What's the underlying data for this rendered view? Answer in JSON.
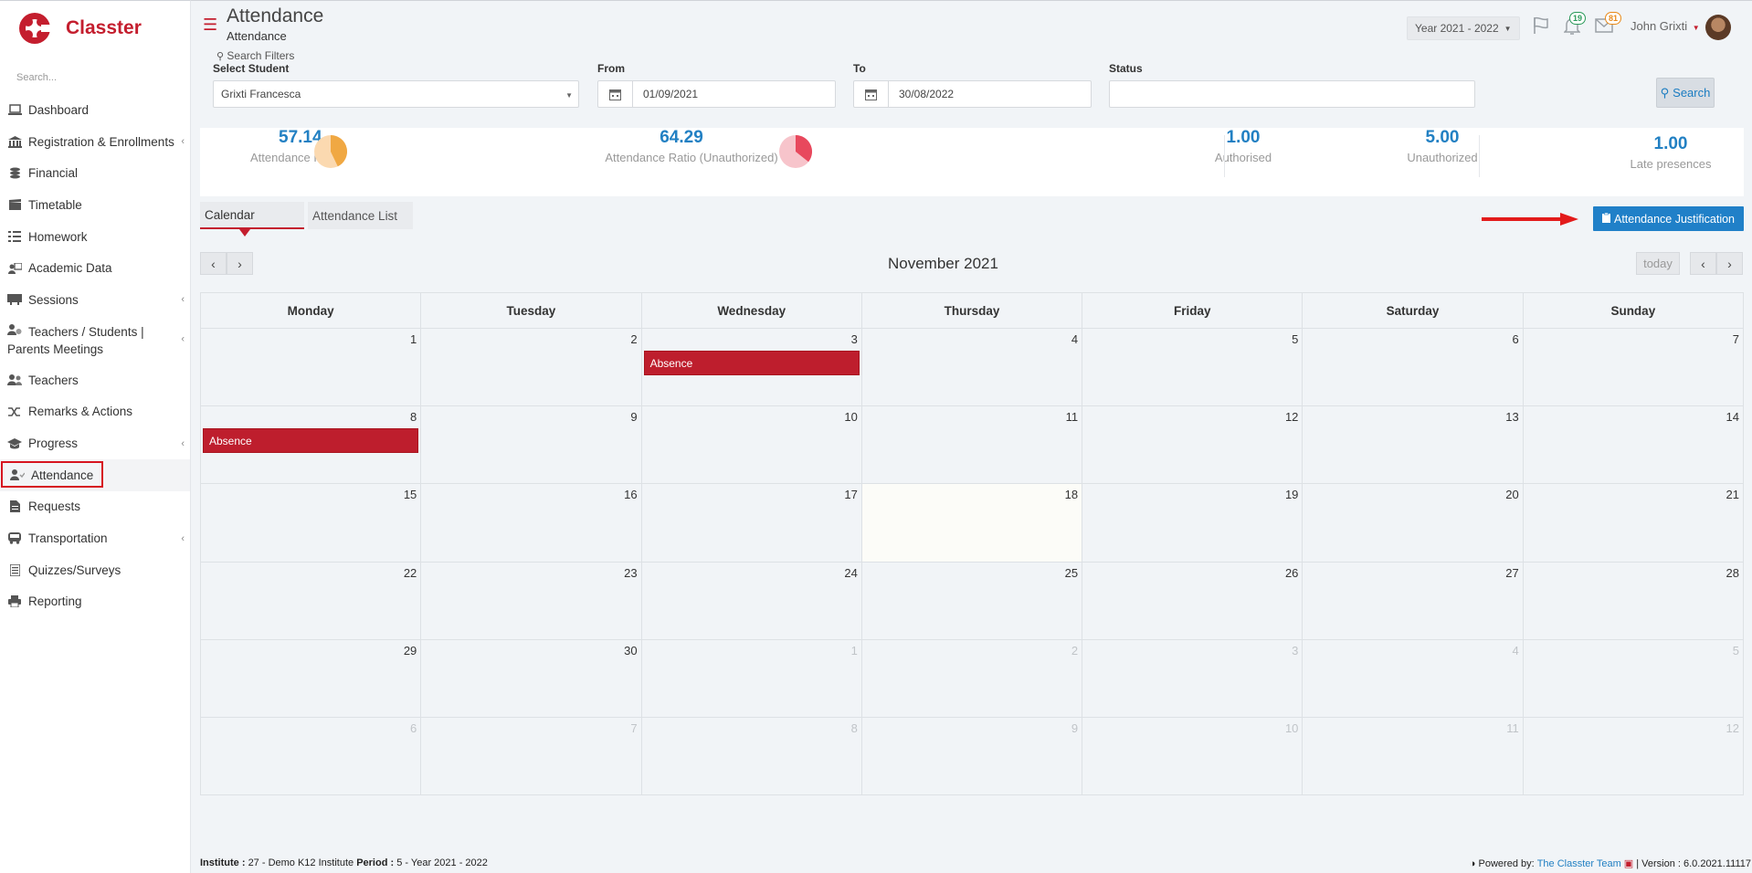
{
  "brand": {
    "name": "Classter"
  },
  "sidebar": {
    "search_placeholder": "Search...",
    "items": [
      {
        "label": "Dashboard"
      },
      {
        "label": "Registration & Enrollments"
      },
      {
        "label": "Financial"
      },
      {
        "label": "Timetable"
      },
      {
        "label": "Homework"
      },
      {
        "label": "Academic Data"
      },
      {
        "label": "Sessions"
      },
      {
        "label": "Teachers / Students |",
        "label2": "Parents Meetings"
      },
      {
        "label": "Teachers"
      },
      {
        "label": "Remarks & Actions"
      },
      {
        "label": "Progress"
      },
      {
        "label": "Attendance"
      },
      {
        "label": "Requests"
      },
      {
        "label": "Transportation"
      },
      {
        "label": "Quizzes/Surveys"
      },
      {
        "label": "Reporting"
      }
    ]
  },
  "header": {
    "title": "Attendance",
    "subtitle": "Attendance",
    "year": "Year 2021 - 2022",
    "notifications": "19",
    "messages": "81",
    "user": "John Grixti"
  },
  "filters": {
    "search_filters": "Search Filters",
    "student_label": "Select Student",
    "student_value": "Grixti Francesca",
    "from_label": "From",
    "from_value": "01/09/2021",
    "to_label": "To",
    "to_value": "30/08/2022",
    "status_label": "Status",
    "status_value": "",
    "search_button": "Search"
  },
  "stats": [
    {
      "value": "57.14",
      "label": "Attendance Ratio",
      "ratio": 0.5714
    },
    {
      "value": "64.29",
      "label": "Attendance Ratio (Unauthorized)",
      "ratio": 0.6429
    },
    {
      "value": "1.00",
      "label": "Authorised"
    },
    {
      "value": "5.00",
      "label": "Unauthorized"
    },
    {
      "value": "1.00",
      "label": "Late presences"
    }
  ],
  "tabs": {
    "calendar": "Calendar",
    "list": "Attendance List"
  },
  "justify_button": "Attendance Justification",
  "calendar": {
    "month": "November 2021",
    "today_label": "today",
    "prev": "‹",
    "next": "›",
    "days": [
      "Monday",
      "Tuesday",
      "Wednesday",
      "Thursday",
      "Friday",
      "Saturday",
      "Sunday"
    ],
    "weeks": [
      [
        {
          "d": "1"
        },
        {
          "d": "2"
        },
        {
          "d": "3",
          "event": "Absence"
        },
        {
          "d": "4"
        },
        {
          "d": "5"
        },
        {
          "d": "6"
        },
        {
          "d": "7"
        }
      ],
      [
        {
          "d": "8",
          "event": "Absence"
        },
        {
          "d": "9"
        },
        {
          "d": "10"
        },
        {
          "d": "11"
        },
        {
          "d": "12"
        },
        {
          "d": "13"
        },
        {
          "d": "14"
        }
      ],
      [
        {
          "d": "15"
        },
        {
          "d": "16"
        },
        {
          "d": "17"
        },
        {
          "d": "18",
          "today": true
        },
        {
          "d": "19"
        },
        {
          "d": "20"
        },
        {
          "d": "21"
        }
      ],
      [
        {
          "d": "22"
        },
        {
          "d": "23"
        },
        {
          "d": "24"
        },
        {
          "d": "25"
        },
        {
          "d": "26"
        },
        {
          "d": "27"
        },
        {
          "d": "28"
        }
      ],
      [
        {
          "d": "29"
        },
        {
          "d": "30"
        },
        {
          "d": "1",
          "other": true
        },
        {
          "d": "2",
          "other": true
        },
        {
          "d": "3",
          "other": true
        },
        {
          "d": "4",
          "other": true
        },
        {
          "d": "5",
          "other": true
        }
      ],
      [
        {
          "d": "6",
          "other": true
        },
        {
          "d": "7",
          "other": true
        },
        {
          "d": "8",
          "other": true
        },
        {
          "d": "9",
          "other": true
        },
        {
          "d": "10",
          "other": true
        },
        {
          "d": "11",
          "other": true
        },
        {
          "d": "12",
          "other": true
        }
      ]
    ]
  },
  "footer": {
    "institute_label": "Institute :",
    "institute_value": "27 - Demo K12 Institute",
    "period_label": "Period :",
    "period_value": "5 - Year 2021 - 2022",
    "powered": "Powered by:",
    "team": "The Classter Team",
    "version": "| Version : 6.0.2021.11117"
  },
  "colors": {
    "brand": "#c41e2e",
    "accent": "#2080c8",
    "event": "#be1e2d",
    "pie1": "#f0a843",
    "pie2": "#e8485d"
  }
}
